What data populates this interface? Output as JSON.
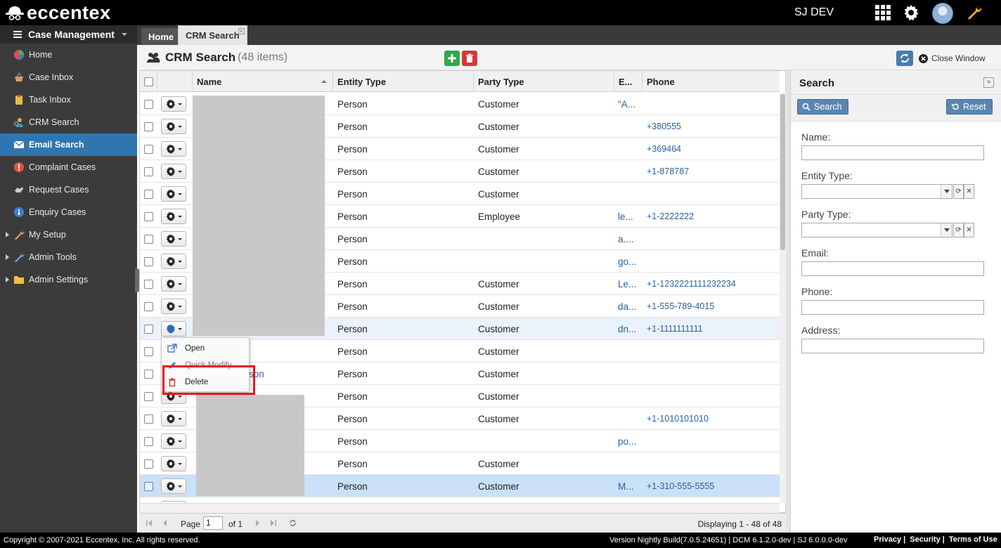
{
  "app": {
    "brand": "eccentex",
    "user": "SJ DEV"
  },
  "sidebar": {
    "header": "Case Management",
    "items": [
      {
        "label": "Home",
        "icon": "home-icon"
      },
      {
        "label": "Case Inbox",
        "icon": "basket-icon"
      },
      {
        "label": "Task Inbox",
        "icon": "clipboard-icon"
      },
      {
        "label": "CRM Search",
        "icon": "person-search-icon"
      },
      {
        "label": "Email Search",
        "icon": "envelope-icon"
      },
      {
        "label": "Complaint Cases",
        "icon": "alert-icon"
      },
      {
        "label": "Request Cases",
        "icon": "hand-icon"
      },
      {
        "label": "Enquiry Cases",
        "icon": "info-icon"
      },
      {
        "label": "My Setup",
        "icon": "wrench-icon"
      },
      {
        "label": "Admin Tools",
        "icon": "wrench-icon"
      },
      {
        "label": "Admin Settings",
        "icon": "folder-icon"
      }
    ]
  },
  "tabs": {
    "home": "Home",
    "crm": "CRM Search"
  },
  "titlebar": {
    "title": "CRM Search",
    "count": "(48 items)",
    "close_window": "Close Window"
  },
  "grid": {
    "columns": {
      "name": "Name",
      "entity": "Entity Type",
      "party": "Party Type",
      "email": "E...",
      "phone": "Phone"
    },
    "rows": [
      {
        "name": "",
        "entity": "Person",
        "party": "Customer",
        "email": "\"A...",
        "phone": ""
      },
      {
        "name": "",
        "entity": "Person",
        "party": "Customer",
        "email": "",
        "phone": "+380555"
      },
      {
        "name": "",
        "entity": "Person",
        "party": "Customer",
        "email": "",
        "phone": "+369464"
      },
      {
        "name": "",
        "entity": "Person",
        "party": "Customer",
        "email": "",
        "phone": "+1-878787"
      },
      {
        "name": "",
        "entity": "Person",
        "party": "Customer",
        "email": "",
        "phone": ""
      },
      {
        "name": "",
        "entity": "Person",
        "party": "Employee",
        "email": "le...",
        "phone": "+1-2222222"
      },
      {
        "name": "",
        "entity": "Person",
        "party": "",
        "email": "a....",
        "phone": ""
      },
      {
        "name": "",
        "entity": "Person",
        "party": "",
        "email": "go...",
        "phone": ""
      },
      {
        "name": "",
        "entity": "Person",
        "party": "Customer",
        "email": "Le...",
        "phone": "+1-1232221111232234"
      },
      {
        "name": "",
        "entity": "Person",
        "party": "Customer",
        "email": "da...",
        "phone": "+1-555-789-4015"
      },
      {
        "name": "",
        "entity": "Person",
        "party": "Customer",
        "email": "dn...",
        "phone": "+1-1111111111"
      },
      {
        "name": "",
        "entity": "Person",
        "party": "Customer",
        "email": "",
        "phone": ""
      },
      {
        "name": "son",
        "entity": "Person",
        "party": "Customer",
        "email": "",
        "phone": ""
      },
      {
        "name": "",
        "entity": "Person",
        "party": "Customer",
        "email": "",
        "phone": ""
      },
      {
        "name": "",
        "entity": "Person",
        "party": "Customer",
        "email": "",
        "phone": "+1-1010101010"
      },
      {
        "name": "",
        "entity": "Person",
        "party": "",
        "email": "po...",
        "phone": ""
      },
      {
        "name": "",
        "entity": "Person",
        "party": "Customer",
        "email": "",
        "phone": ""
      },
      {
        "name": "",
        "entity": "Person",
        "party": "Customer",
        "email": "M...",
        "phone": "+1-310-555-5555"
      }
    ]
  },
  "context_menu": {
    "open": "Open",
    "quick_modify": "Quick Modify",
    "delete": "Delete"
  },
  "pager": {
    "page_label": "Page",
    "page_value": "1",
    "of": "of 1",
    "displaying": "Displaying 1 - 48 of 48"
  },
  "search_panel": {
    "title": "Search",
    "search_button": "Search",
    "reset_button": "Reset",
    "labels": {
      "name": "Name:",
      "entity": "Entity Type:",
      "party": "Party Type:",
      "email": "Email:",
      "phone": "Phone:",
      "address": "Address:"
    }
  },
  "footer": {
    "copyright": "Copyright © 2007-2021 Eccentex, Inc. All rights reserved.",
    "version": "Version  Nightly Build(7.0.5.24651) | DCM 6.1.2.0-dev | SJ 6.0.0.0-dev",
    "privacy": "Privacy",
    "security": "Security",
    "terms": "Terms of Use"
  },
  "colors": {
    "accent": "#2f76b0",
    "topbar": "#000000",
    "sidebar": "#3b3b3b",
    "highlight": "#e8141c",
    "add": "#2ea84a",
    "delete": "#d9363e"
  }
}
